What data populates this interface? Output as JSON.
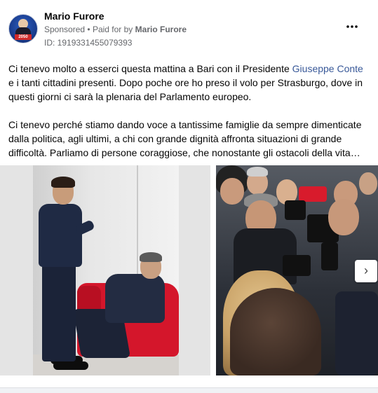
{
  "ad": {
    "page_name": "Mario Furore",
    "sponsored_label": "Sponsored",
    "separator": "•",
    "paid_for_prefix": "Paid for by",
    "payer": "Mario Furore",
    "id_label": "ID: 1919331455079393",
    "more_icon": "more-horizontal-icon",
    "avatar_badge": "2050"
  },
  "post": {
    "para1_before": "Ci tenevo molto a esserci questa mattina a Bari con il Presidente ",
    "para1_mention": "Giuseppe Conte",
    "para1_after": " e i tanti cittadini presenti. Dopo poche ore ho preso il volo per Strasburgo, dove in questi giorni ci sarà la plenaria del Parlamento europeo.",
    "para2": "Ci tenevo perché stiamo dando voce a tantissime famiglie da sempre dimenticate dalla politica, agli ultimi, a chi con grande dignità affronta situazioni di grande difficoltà. Parliamo di persone coraggiose, che nonostante gli ostacoli della vita…"
  },
  "gallery": {
    "next_icon": "chevron-right-icon",
    "next_glyph": "›"
  },
  "colors": {
    "mention": "#385898",
    "chair": "#d4162b",
    "meta": "#65676b"
  }
}
